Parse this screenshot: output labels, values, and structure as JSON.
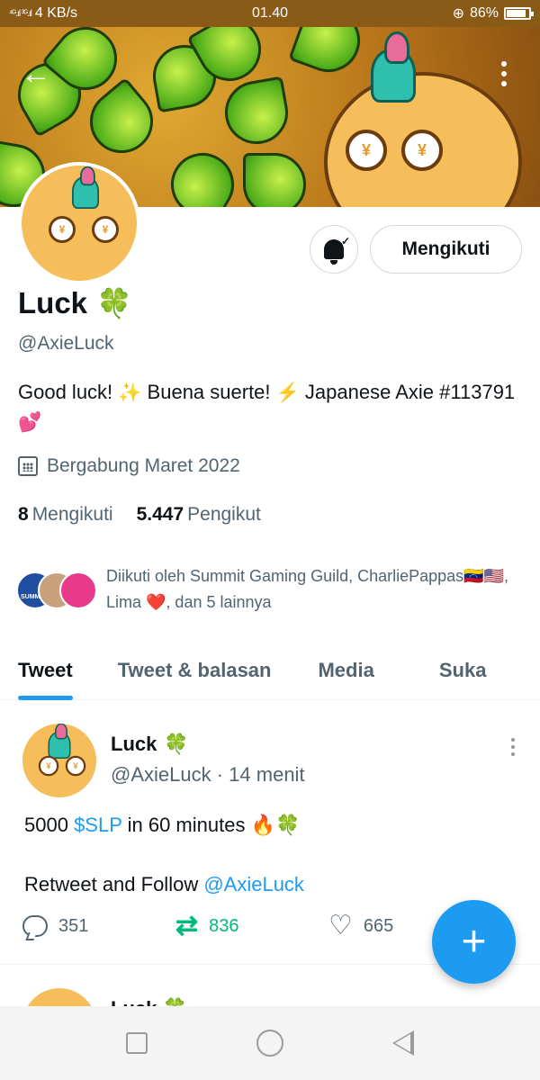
{
  "status_bar": {
    "signal": "⁴ᴳ.ıl ³ᴳ.ıl",
    "speed": "4 KB/s",
    "time": "01.40",
    "battery": "86%",
    "battery_level": 0.86
  },
  "header": {
    "back_icon": "arrow-left-icon",
    "more_icon": "more-vertical-icon"
  },
  "profile": {
    "name": "Luck",
    "name_emoji": "🍀",
    "handle": "@AxieLuck",
    "bio_1": "Good luck! ",
    "bio_emoji_1": "✨",
    "bio_2": " Buena suerte! ",
    "bio_emoji_2": "⚡",
    "bio_3": " Japanese Axie #113791 ",
    "bio_emoji_3": "💕",
    "joined": "Bergabung Maret 2022",
    "following_count": "8",
    "following_label": "Mengikuti",
    "followers_count": "5.447",
    "followers_label": "Pengikut",
    "followed_by": "Diikuti oleh Summit Gaming Guild, CharliePappas🇻🇪🇺🇸, Lima ❤️, dan 5 lainnya"
  },
  "actions": {
    "follow_label": "Mengikuti",
    "bell_icon": "bell-check-icon"
  },
  "tabs": [
    {
      "label": "Tweet",
      "active": true
    },
    {
      "label": "Tweet & balasan",
      "active": false
    },
    {
      "label": "Media",
      "active": false
    },
    {
      "label": "Suka",
      "active": false
    }
  ],
  "tweet": {
    "name": "Luck",
    "name_emoji": "🍀",
    "handle": "@AxieLuck",
    "time": "14 menit",
    "line1_a": "5000 ",
    "line1_link": "$SLP",
    "line1_b": " in 60 minutes ",
    "line1_emoji": "🔥🍀",
    "line2_a": "Retweet and Follow ",
    "line2_link": "@AxieLuck",
    "replies": "351",
    "retweets": "836",
    "likes": "665"
  },
  "tweet2": {
    "name": "Luck",
    "name_emoji": "🍀"
  },
  "fab_label": "+",
  "colors": {
    "accent": "#1d9bf0",
    "retweet": "#00ba7c",
    "secondary_text": "#536471"
  }
}
